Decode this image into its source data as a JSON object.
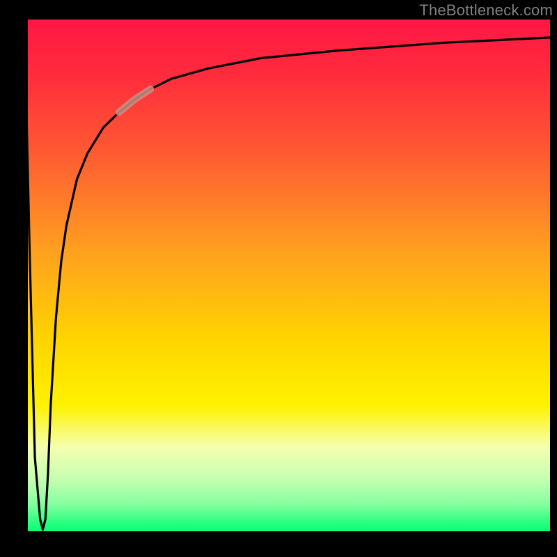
{
  "watermark": "TheBottleneck.com",
  "colors": {
    "curve": "#000000",
    "highlight": "#c99085",
    "axis": "#000000",
    "gradient_top": "#ff1744",
    "gradient_mid": "#ffd400",
    "gradient_bottom": "#02ff6a"
  },
  "chart_data": {
    "type": "line",
    "title": "",
    "xlabel": "",
    "ylabel": "",
    "xlim": [
      0,
      100
    ],
    "ylim": [
      0,
      100
    ],
    "annotations": [
      {
        "text": "highlighted segment",
        "x_start": 18,
        "x_end": 24
      }
    ],
    "series": [
      {
        "name": "bottleneck-curve",
        "x": [
          0,
          1,
          2,
          3,
          3.5,
          4,
          4.5,
          5,
          6,
          7,
          8,
          10,
          12,
          15,
          18,
          21,
          24,
          28,
          35,
          45,
          60,
          80,
          100
        ],
        "y": [
          100,
          55,
          15,
          3,
          1,
          3,
          12,
          25,
          42,
          53,
          60,
          69,
          74,
          79,
          82,
          84.5,
          86.5,
          88.5,
          90.5,
          92.5,
          94,
          95.5,
          96.5
        ]
      }
    ]
  }
}
